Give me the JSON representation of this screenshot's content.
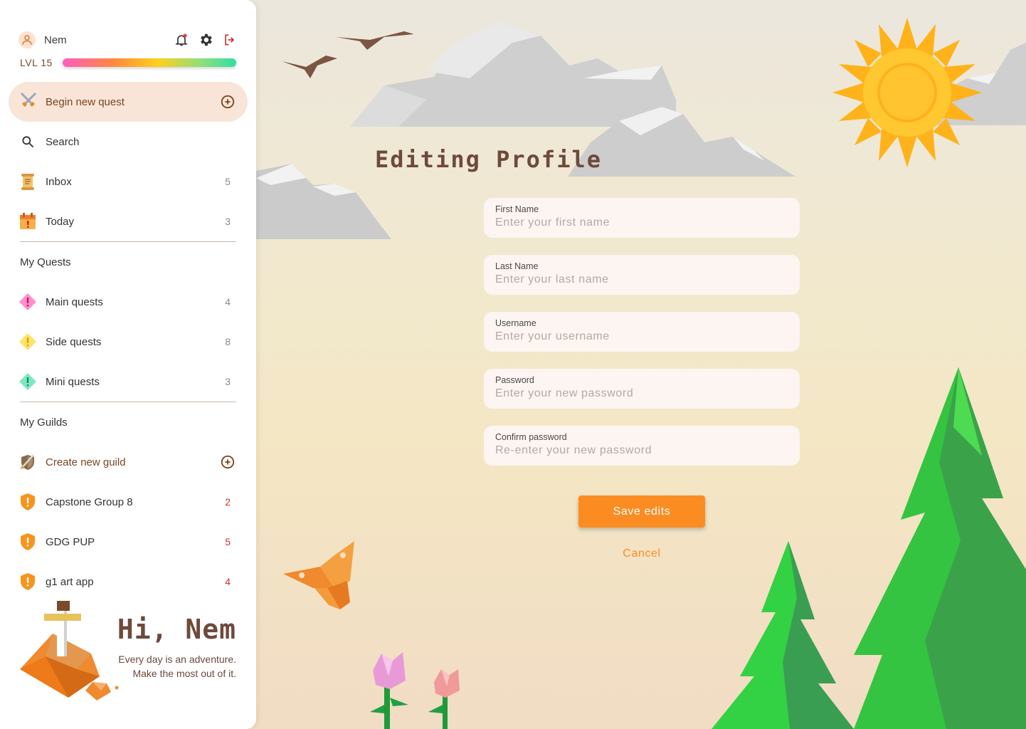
{
  "user": {
    "name": "Nem",
    "level_label": "LVL 15"
  },
  "icons": {
    "avatar": "user-icon",
    "notifications": "bell-icon",
    "settings": "gear-icon",
    "logout": "logout-icon"
  },
  "sidebar": {
    "begin_quest_label": "Begin new quest",
    "nav": [
      {
        "label": "Search",
        "icon": "search-icon"
      },
      {
        "label": "Inbox",
        "count": "5",
        "icon": "scroll-icon"
      },
      {
        "label": "Today",
        "count": "3",
        "icon": "calendar-icon"
      }
    ],
    "quests_title": "My Quests",
    "quests": [
      {
        "label": "Main quests",
        "count": "4",
        "color": "#ff8fd0"
      },
      {
        "label": "Side quests",
        "count": "8",
        "color": "#ffe36a"
      },
      {
        "label": "Mini quests",
        "count": "3",
        "color": "#7fe8c2"
      }
    ],
    "guilds_title": "My Guilds",
    "create_guild_label": "Create new guild",
    "guilds": [
      {
        "label": "Capstone Group 8",
        "count": "2"
      },
      {
        "label": "GDG PUP",
        "count": "5"
      },
      {
        "label": "g1 art app",
        "count": "4"
      }
    ]
  },
  "greeting": {
    "title": "Hi, Nem",
    "subtitle": "Every day is an adventure. Make the most out of it."
  },
  "form": {
    "title": "Editing Profile",
    "fields": [
      {
        "label": "First Name",
        "placeholder": "Enter your first name"
      },
      {
        "label": "Last Name",
        "placeholder": "Enter your last name"
      },
      {
        "label": "Username",
        "placeholder": "Enter your username"
      },
      {
        "label": "Password",
        "placeholder": "Enter your new password"
      },
      {
        "label": "Confirm password",
        "placeholder": "Re-enter your new password"
      }
    ],
    "save_label": "Save edits",
    "cancel_label": "Cancel"
  },
  "colors": {
    "accent": "#fb8c22",
    "brown_text": "#6e4a3b",
    "badge_red": "#d32f2f",
    "begin_quest_bg": "#f8e5d7",
    "field_bg": "#fdf5f1"
  }
}
